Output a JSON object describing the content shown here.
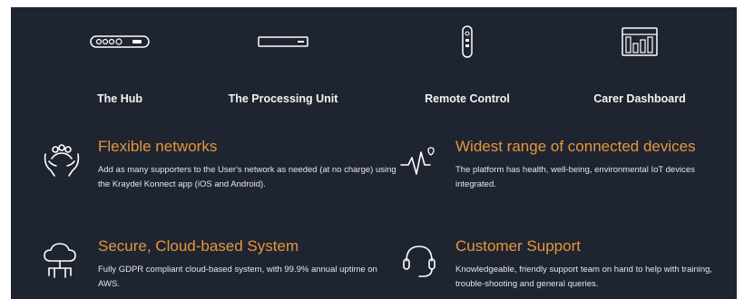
{
  "products": [
    {
      "label": "The Hub",
      "icon": "hub-device-icon"
    },
    {
      "label": "The Processing Unit",
      "icon": "processing-unit-icon"
    },
    {
      "label": "Remote Control",
      "icon": "remote-control-icon"
    },
    {
      "label": "Carer Dashboard",
      "icon": "dashboard-icon"
    }
  ],
  "features": [
    {
      "title": "Flexible networks",
      "description": "Add as many supporters to the User's network as needed (at no charge) using the Kraydel Konnect app (iOS and Android).",
      "icon": "people-hands-icon"
    },
    {
      "title": "Widest range of connected devices",
      "description": "The platform has health, well-being, environmental IoT devices integrated.",
      "icon": "heartbeat-icon"
    },
    {
      "title": "Secure, Cloud-based System",
      "description": "Fully GDPR compliant cloud-based system, with 99.9% annual uptime on AWS.",
      "icon": "cloud-network-icon"
    },
    {
      "title": "Customer Support",
      "description": "Knowledgeable, friendly support team on hand to help with training, trouble-shooting and general queries.",
      "icon": "headset-icon"
    }
  ],
  "colors": {
    "background": "#1e2530",
    "accent": "#e8953b",
    "text": "#ffffff"
  }
}
